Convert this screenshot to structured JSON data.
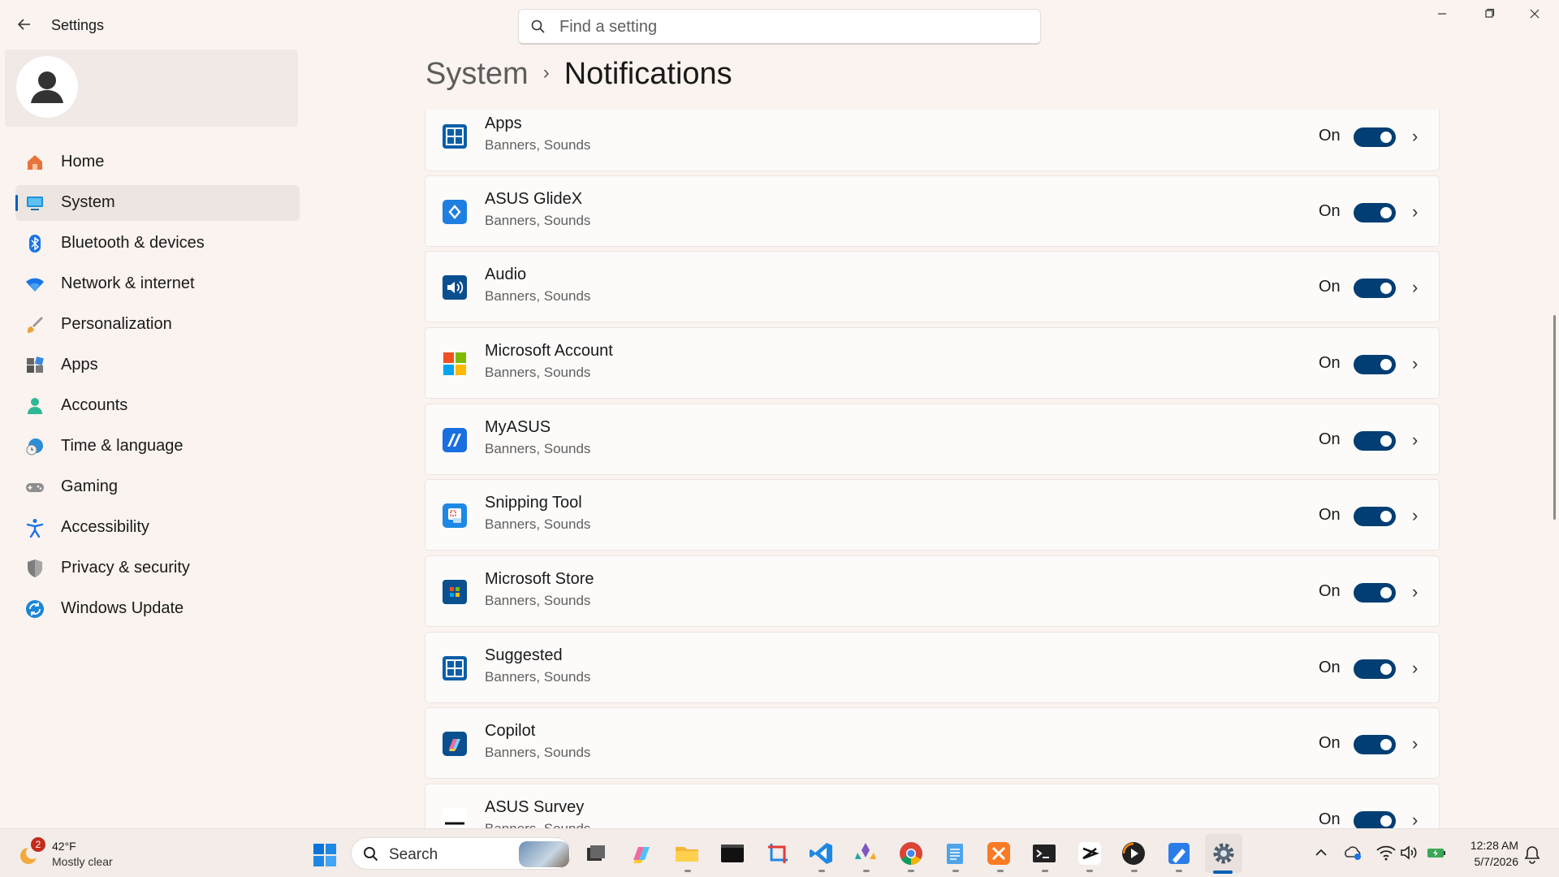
{
  "window": {
    "title": "Settings",
    "back_icon": "arrow-left-icon",
    "min_icon": "minimize-icon",
    "max_icon": "maximize-icon",
    "close_icon": "close-icon"
  },
  "search": {
    "placeholder": "Find a setting",
    "icon": "search-icon"
  },
  "sidebar": {
    "items": [
      {
        "label": "Home",
        "icon": "home-icon",
        "active": false
      },
      {
        "label": "System",
        "icon": "monitor-icon",
        "active": true
      },
      {
        "label": "Bluetooth & devices",
        "icon": "bluetooth-icon",
        "active": false
      },
      {
        "label": "Network & internet",
        "icon": "wifi-icon",
        "active": false
      },
      {
        "label": "Personalization",
        "icon": "brush-icon",
        "active": false
      },
      {
        "label": "Apps",
        "icon": "apps-icon",
        "active": false
      },
      {
        "label": "Accounts",
        "icon": "person-icon",
        "active": false
      },
      {
        "label": "Time & language",
        "icon": "clock-globe-icon",
        "active": false
      },
      {
        "label": "Gaming",
        "icon": "gamepad-icon",
        "active": false
      },
      {
        "label": "Accessibility",
        "icon": "accessibility-icon",
        "active": false
      },
      {
        "label": "Privacy & security",
        "icon": "shield-icon",
        "active": false
      },
      {
        "label": "Windows Update",
        "icon": "update-icon",
        "active": false
      }
    ]
  },
  "header": {
    "parent": "System",
    "separator": "›",
    "current": "Notifications"
  },
  "notifications": {
    "rows": [
      {
        "title": "Apps",
        "subtitle": "Banners, Sounds",
        "state": "On",
        "icon": "apps-grid-icon"
      },
      {
        "title": "ASUS GlideX",
        "subtitle": "Banners, Sounds",
        "state": "On",
        "icon": "glidex-icon"
      },
      {
        "title": "Audio",
        "subtitle": "Banners, Sounds",
        "state": "On",
        "icon": "speaker-icon"
      },
      {
        "title": "Microsoft Account",
        "subtitle": "Banners, Sounds",
        "state": "On",
        "icon": "microsoft-logo-icon"
      },
      {
        "title": "MyASUS",
        "subtitle": "Banners, Sounds",
        "state": "On",
        "icon": "myasus-icon"
      },
      {
        "title": "Snipping Tool",
        "subtitle": "Banners, Sounds",
        "state": "On",
        "icon": "snipping-tool-icon"
      },
      {
        "title": "Microsoft Store",
        "subtitle": "Banners, Sounds",
        "state": "On",
        "icon": "store-icon"
      },
      {
        "title": "Suggested",
        "subtitle": "Banners, Sounds",
        "state": "On",
        "icon": "apps-grid-icon"
      },
      {
        "title": "Copilot",
        "subtitle": "Banners, Sounds",
        "state": "On",
        "icon": "copilot-icon"
      },
      {
        "title": "ASUS Survey",
        "subtitle": "Banners, Sounds",
        "state": "On",
        "icon": "asus-icon"
      }
    ]
  },
  "taskbar": {
    "weather": {
      "temp": "42°F",
      "desc": "Mostly clear",
      "badge": "2",
      "icon": "weather-moon-icon"
    },
    "search_label": "Search",
    "apps": [
      "task-view-icon",
      "copilot-icon",
      "file-explorer-icon",
      "terminal-icon",
      "snipping-tool-icon",
      "vscode-icon",
      "app-icon",
      "chrome-icon",
      "notepad-icon",
      "xampp-icon",
      "terminal-icon",
      "capcut-icon",
      "media-player-icon",
      "paint-icon",
      "settings-gear-icon"
    ],
    "clock": {
      "time": "12:28 AM",
      "date": "5/7/2026"
    }
  },
  "colors": {
    "accent": "#005fb8",
    "toggle_on": "#003e73",
    "background": "#faf3ef"
  }
}
